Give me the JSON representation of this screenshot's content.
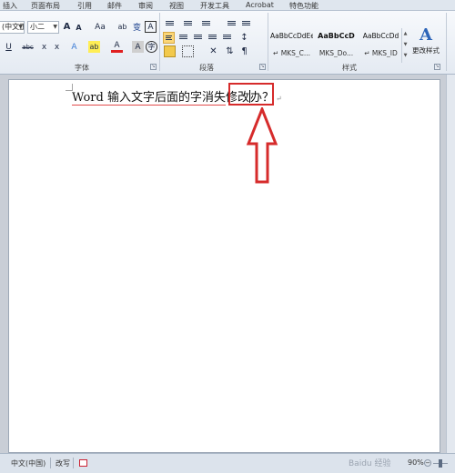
{
  "tabs": [
    "插入",
    "页面布局",
    "引用",
    "邮件",
    "审阅",
    "视图",
    "开发工具",
    "Acrobat",
    "特色功能"
  ],
  "font": {
    "family_value": "(中文正",
    "size_value": "小二",
    "buttons": [
      "A",
      "A",
      "Aa",
      "ab",
      "变",
      "A",
      "U",
      "abc",
      "x",
      "x",
      "A",
      "ab",
      "A",
      "A",
      "字"
    ],
    "group_label": "字体"
  },
  "paragraph": {
    "group_label": "段落"
  },
  "styles": {
    "items": [
      {
        "preview": "AaBbCcDdEe",
        "name": "MKS_C..."
      },
      {
        "preview": "AaBbCcD",
        "name": "MKS_Do..."
      },
      {
        "preview": "AaBbCcDd",
        "name": "MKS_ID"
      }
    ],
    "group_label": "样式",
    "change_styles_label": "更改样式",
    "change_styles_glyph": "A"
  },
  "document": {
    "text_before": "Word 输入文字后面的字消失",
    "text_highlight": "修改",
    "text_after": "办？",
    "para_mark": "↵"
  },
  "annotation": {
    "arrow_color": "#d62b2b",
    "box_color": "#d62b2b"
  },
  "statusbar": {
    "language": "中文(中国)",
    "mode": "改写",
    "zoom": "90%",
    "watermark": "Baidu 经验"
  }
}
